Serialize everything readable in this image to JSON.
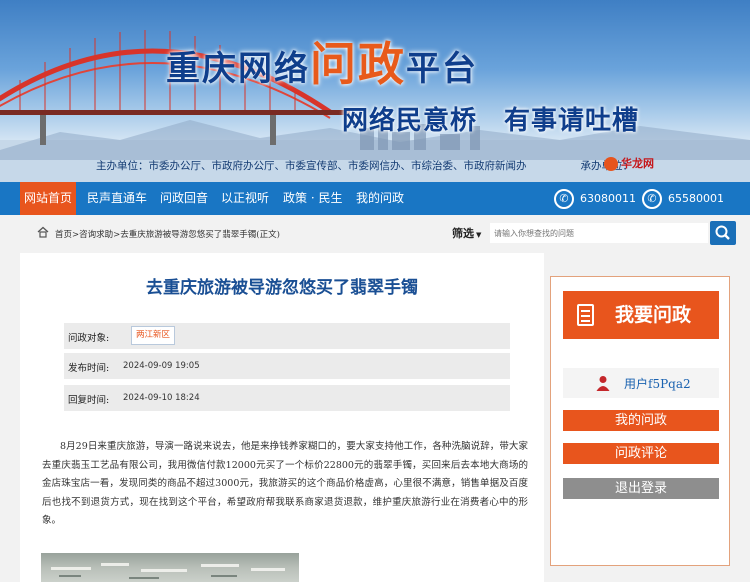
{
  "banner": {
    "title_pre": "重庆网络",
    "title_highlight": "问政",
    "title_post": "平台",
    "slogan": "网络民意桥　有事请吐槽",
    "sponsor": "主办单位：市委办公厅、市政府办公厅、市委宣传部、市委网信办、市综治委、市政府新闻办",
    "organizer": "承办单位：",
    "organizer_logo": "华龙网"
  },
  "nav": {
    "items": [
      "网站首页",
      "民声直通车",
      "问政回音",
      "以正视听",
      "政策 · 民生",
      "我的问政"
    ],
    "phones": [
      "63080011",
      "65580001"
    ]
  },
  "breadcrumb": "首页>咨询求助>去重庆旅游被导游忽悠买了翡翠手镯(正文)",
  "search": {
    "filter_label": "筛选",
    "placeholder": "请输入你想查找的问题"
  },
  "article": {
    "title": "去重庆旅游被导游忽悠买了翡翠手镯",
    "meta": {
      "target_label": "问政对象:",
      "target_value": "两江新区",
      "post_label": "发布时间:",
      "post_time": "2024-09-09 19:05",
      "reply_label": "回复时间:",
      "reply_time": "2024-09-10 18:24"
    },
    "body": "8月29日来重庆旅游，导演一路说来说去，他是来挣钱养家糊口的，要大家支持他工作，各种洗脑说辞，带大家去重庆翡玉工艺品有限公司，我用微信付款12000元买了一个标价22800元的翡翠手镯，买回来后去本地大商场的金店珠宝店一看，发现同类的商品不超过3000元，我旅游买的这个商品价格虚高，心里很不满意，销售单据及百度后也找不到退货方式，现在找到这个平台，希望政府帮我联系商家退货退款，维护重庆旅游行业在消费者心中的形象。"
  },
  "sidebar": {
    "ask_label": "我要问政",
    "user_name": "用户f5Pqa2",
    "my_questions": "我的问政",
    "comments": "问政评论",
    "logout": "退出登录"
  },
  "colors": {
    "nav_blue": "#1976c4",
    "accent_orange": "#e8551d",
    "title_blue": "#1a4f94",
    "logout_gray": "#8e8e8e"
  }
}
